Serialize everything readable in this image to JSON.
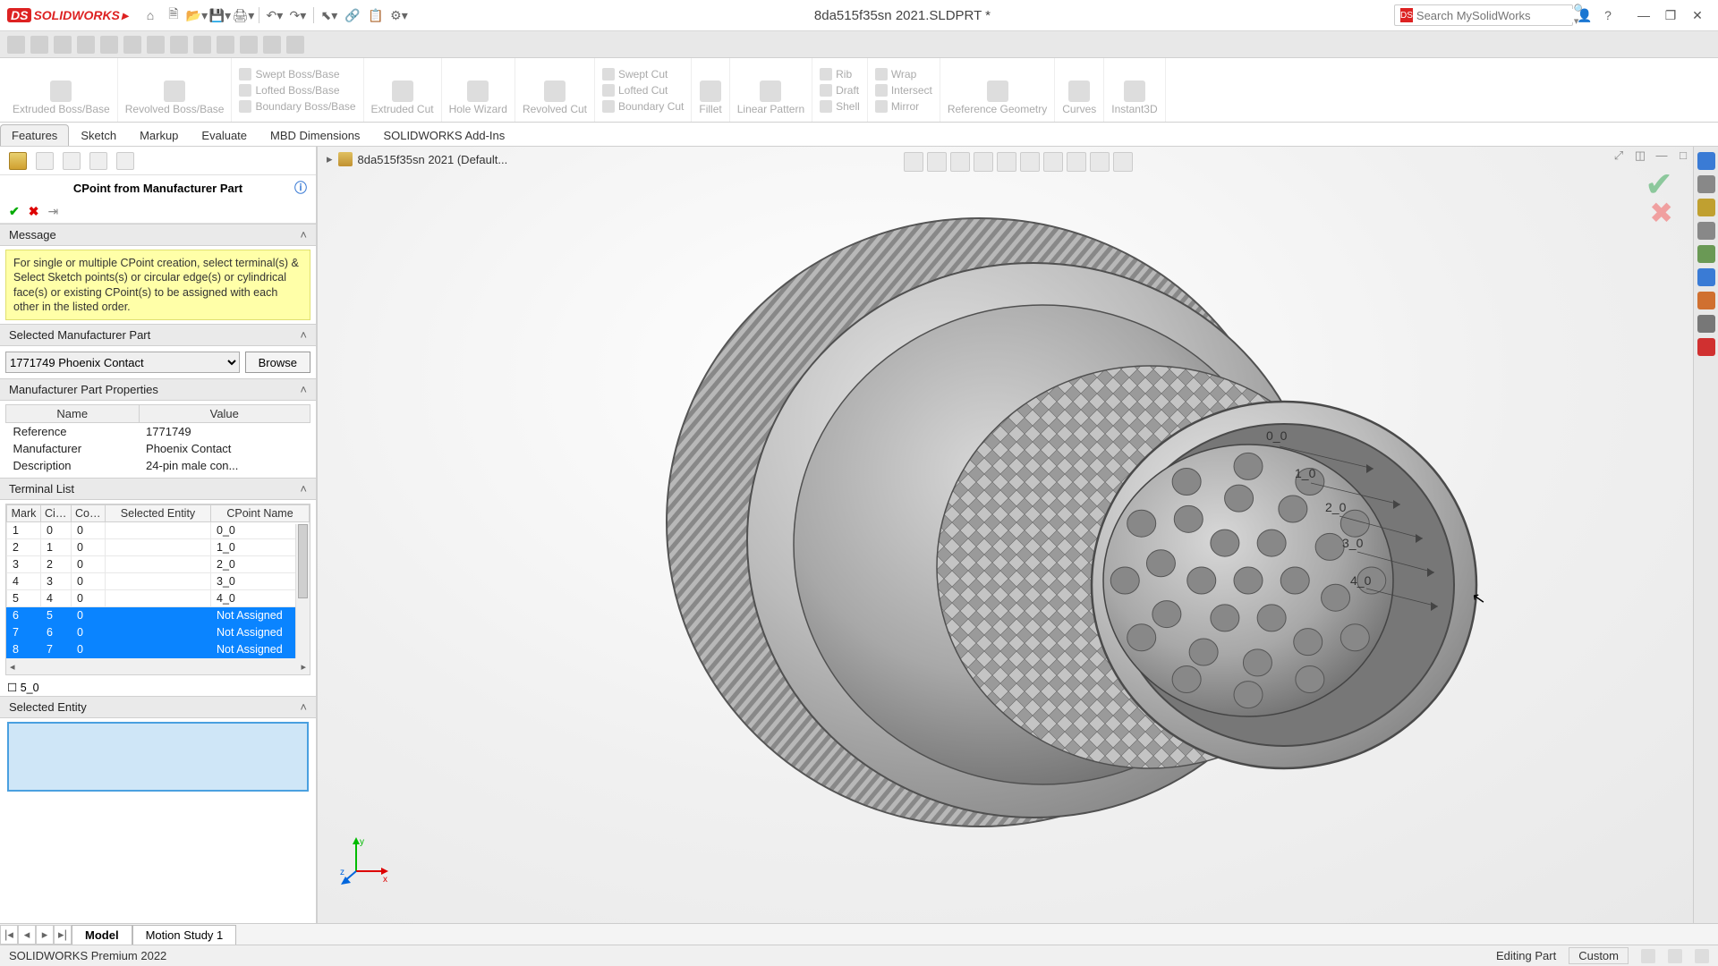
{
  "app": {
    "brand": "SOLIDWORKS",
    "title": "8da515f35sn 2021.SLDPRT *",
    "search_placeholder": "Search MySolidWorks"
  },
  "ribbon": {
    "extruded": "Extruded\nBoss/Base",
    "revolved": "Revolved\nBoss/Base",
    "swept": "Swept Boss/Base",
    "lofted": "Lofted Boss/Base",
    "boundary": "Boundary Boss/Base",
    "ext_cut": "Extruded\nCut",
    "hole": "Hole\nWizard",
    "rev_cut": "Revolved\nCut",
    "swept_cut": "Swept Cut",
    "lofted_cut": "Lofted Cut",
    "boundary_cut": "Boundary Cut",
    "fillet": "Fillet",
    "linear": "Linear\nPattern",
    "rib": "Rib",
    "draft": "Draft",
    "shell": "Shell",
    "wrap": "Wrap",
    "intersect": "Intersect",
    "mirror": "Mirror",
    "refgeo": "Reference\nGeometry",
    "curves": "Curves",
    "instant3d": "Instant3D"
  },
  "tabs": [
    "Features",
    "Sketch",
    "Markup",
    "Evaluate",
    "MBD Dimensions",
    "SOLIDWORKS Add-Ins"
  ],
  "breadcrumb": "8da515f35sn 2021 (Default...",
  "panel": {
    "title": "CPoint from Manufacturer Part",
    "message_head": "Message",
    "message": "For single or multiple CPoint creation, select terminal(s) & Select Sketch points(s) or circular edge(s) or cylindrical face(s) or existing CPoint(s) to be assigned with each other in the listed order.",
    "sel_head": "Selected Manufacturer Part",
    "sel_value": "1771749 Phoenix Contact",
    "browse": "Browse",
    "props_head": "Manufacturer Part Properties",
    "props_cols": {
      "name": "Name",
      "value": "Value"
    },
    "props": [
      {
        "n": "Reference",
        "v": "1771749"
      },
      {
        "n": "Manufacturer",
        "v": "Phoenix Contact"
      },
      {
        "n": "Description",
        "v": "24-pin male con..."
      }
    ],
    "term_head": "Terminal List",
    "term_cols": {
      "mark": "Mark",
      "cir": "Cir…",
      "con": "Con…",
      "entity": "Selected Entity",
      "cpoint": "CPoint Name"
    },
    "terminals": [
      {
        "mark": "1",
        "cir": "0",
        "con": "0",
        "ent": "",
        "cp": "0_0",
        "sel": false
      },
      {
        "mark": "2",
        "cir": "1",
        "con": "0",
        "ent": "",
        "cp": "1_0",
        "sel": false
      },
      {
        "mark": "3",
        "cir": "2",
        "con": "0",
        "ent": "",
        "cp": "2_0",
        "sel": false
      },
      {
        "mark": "4",
        "cir": "3",
        "con": "0",
        "ent": "",
        "cp": "3_0",
        "sel": false
      },
      {
        "mark": "5",
        "cir": "4",
        "con": "0",
        "ent": "",
        "cp": "4_0",
        "sel": false
      },
      {
        "mark": "6",
        "cir": "5",
        "con": "0",
        "ent": "",
        "cp": "Not Assigned",
        "sel": true
      },
      {
        "mark": "7",
        "cir": "6",
        "con": "0",
        "ent": "",
        "cp": "Not Assigned",
        "sel": true
      },
      {
        "mark": "8",
        "cir": "7",
        "con": "0",
        "ent": "",
        "cp": "Not Assigned",
        "sel": true
      }
    ],
    "term_overflow": "5_0",
    "entity_head": "Selected Entity"
  },
  "cp_labels": [
    "0_0",
    "1_0",
    "2_0",
    "3_0",
    "4_0"
  ],
  "bottom": {
    "tabs": [
      "Model",
      "Motion Study 1"
    ],
    "active": 0
  },
  "status": {
    "left": "SOLIDWORKS Premium 2022",
    "mode": "Editing Part",
    "unit": "Custom"
  }
}
